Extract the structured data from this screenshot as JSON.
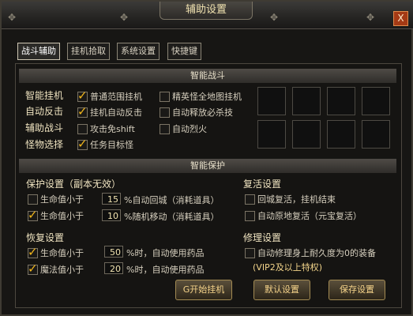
{
  "window": {
    "title": "辅助设置",
    "close_label": "X"
  },
  "tabs": [
    {
      "label": "战斗辅助",
      "active": true
    },
    {
      "label": "挂机拾取",
      "active": false
    },
    {
      "label": "系统设置",
      "active": false
    },
    {
      "label": "快捷键",
      "active": false
    }
  ],
  "sections": {
    "smart_combat": "智能战斗",
    "smart_protect": "智能保护"
  },
  "combat": {
    "row_labels": [
      "智能挂机",
      "自动反击",
      "辅助战斗",
      "怪物选择"
    ],
    "left_options": [
      {
        "label": "普通范围挂机",
        "checked": true
      },
      {
        "label": "挂机自动反击",
        "checked": true
      },
      {
        "label": "攻击免shift",
        "checked": false
      },
      {
        "label": "任务目标怪",
        "checked": true
      }
    ],
    "right_options": [
      {
        "label": "精英怪全地图挂机",
        "checked": false
      },
      {
        "label": "自动释放必杀技",
        "checked": false
      },
      {
        "label": "自动烈火",
        "checked": false
      }
    ]
  },
  "protect": {
    "title": "保护设置（副本无效）",
    "hp1": {
      "prefix": "生命值小于",
      "value": "15",
      "suffix": "%自动回城（消耗道具）",
      "checked": false
    },
    "hp2": {
      "prefix": "生命值小于",
      "value": "10",
      "suffix": "%随机移动（消耗道具）",
      "checked": true
    }
  },
  "revive": {
    "title": "复活设置",
    "opt1": {
      "label": "回城复活，挂机结束",
      "checked": false
    },
    "opt2": {
      "label": "自动原地复活（元宝复活）",
      "checked": false
    }
  },
  "recover": {
    "title": "恢复设置",
    "hp": {
      "prefix": "生命值小于",
      "value": "50",
      "suffix": "%时，自动使用药品",
      "checked": true
    },
    "mp": {
      "prefix": "魔法值小于",
      "value": "20",
      "suffix": "%时，自动使用药品",
      "checked": true
    }
  },
  "repair": {
    "title": "修理设置",
    "opt": {
      "label": "自动修理身上耐久度为0的装备",
      "checked": false
    },
    "note": "(VIP2及以上特权)"
  },
  "buttons": {
    "start": "G开始挂机",
    "default": "默认设置",
    "save": "保存设置"
  }
}
